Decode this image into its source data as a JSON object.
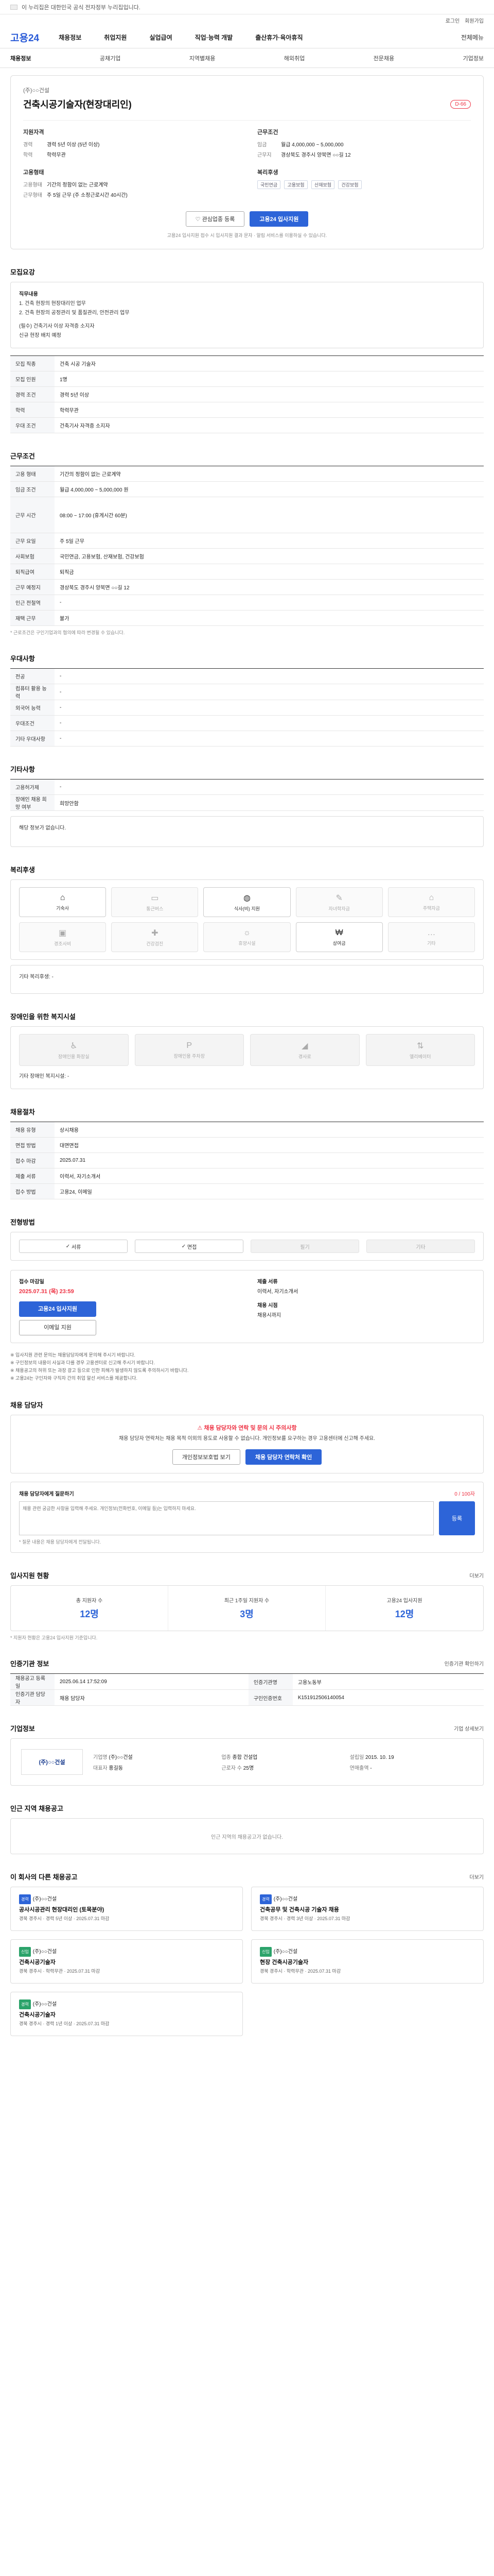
{
  "topbar": {
    "text": "이 누리집은 대한민국 공식 전자정부 누리집입니다."
  },
  "util": {
    "login": "로그인",
    "join": "회원가입"
  },
  "header": {
    "logo": "고용24",
    "gnb": [
      "채용정보",
      "취업지원",
      "실업급여",
      "직업·능력 개발",
      "출산휴가·육아휴직"
    ],
    "allmenu": "전체메뉴"
  },
  "subnav": [
    "채용정보",
    "공채기업",
    "지역별채용",
    "해외취업",
    "전문채용",
    "기업정보"
  ],
  "job": {
    "company": "(주)○○건설",
    "title": "건축시공기술자(현장대리인)",
    "dday": "D-66",
    "left_heading": "지원자격",
    "left": [
      {
        "k": "경력",
        "v": "경력 5년 이상 (5년 이상)"
      },
      {
        "k": "학력",
        "v": "학력무관"
      }
    ],
    "left_heading2": "고용형태",
    "left2": [
      {
        "k": "고용형태",
        "v": "기간의 정함이 없는 근로계약"
      },
      {
        "k": "근무형태",
        "v": "주 5일 근무 (주 소정근로시간 40시간)"
      }
    ],
    "right_heading": "근무조건",
    "right": [
      {
        "k": "임금",
        "v": "월급 4,000,000 ~ 5,000,000"
      },
      {
        "k": "근무지",
        "v": "경상북도 경주시 양북면 ○○길 12"
      }
    ],
    "right_heading2": "복리후생",
    "chips": [
      "국민연금",
      "고용보험",
      "산재보험",
      "건강보험"
    ],
    "btn_save": "관심업종 등록",
    "btn_apply": "고용24 입사지원",
    "notice": "고용24 입사지원 접수 시 입사지원 결과 문자 · 알림 서비스를 이용하실 수 있습니다."
  },
  "recruit": {
    "title": "모집요강",
    "sub": "직무내용",
    "lines": [
      "1. 건축 현장의 현장대리인 업무",
      "2. 건축 현장의 공정관리 및 품질관리, 안전관리 업무",
      "(필수) 건축기사 이상 자격증 소지자",
      "신규 현장 배치 예정"
    ],
    "table": [
      {
        "k": "모집 직종",
        "v": "건축 시공 기술자"
      },
      {
        "k": "모집 인원",
        "v": "1명"
      },
      {
        "k": "경력 조건",
        "v": "경력 5년 이상"
      },
      {
        "k": "학력",
        "v": "학력무관"
      },
      {
        "k": "우대 조건",
        "v": "건축기사 자격증 소지자"
      }
    ]
  },
  "conditions": {
    "title": "근무조건",
    "table": [
      {
        "k": "고용 형태",
        "v": "기간의 정함이 없는 근로계약"
      },
      {
        "k": "임금 조건",
        "v": "월급 4,000,000 ~ 5,000,000 원"
      },
      {
        "k": "근무 시간",
        "v": "08:00 ~ 17:00 (휴게시간 60분)"
      },
      {
        "k": "근무 요일",
        "v": "주 5일 근무"
      },
      {
        "k": "사회보험",
        "v": "국민연금, 고용보험, 산재보험, 건강보험"
      },
      {
        "k": "퇴직급여",
        "v": "퇴직금"
      },
      {
        "k": "근무 예정지",
        "v": "경상북도 경주시 양북면 ○○길 12"
      },
      {
        "k": "인근 전철역",
        "v": "-"
      },
      {
        "k": "재택 근무",
        "v": "불가"
      }
    ],
    "note": "* 근로조건은 구인기업과의 협의에 따라 변경될 수 있습니다."
  },
  "preference": {
    "title": "우대사항",
    "table": [
      {
        "k": "전공",
        "v": "-"
      },
      {
        "k": "컴퓨터 활용 능력",
        "v": "-"
      },
      {
        "k": "외국어 능력",
        "v": "-"
      },
      {
        "k": "우대조건",
        "v": "-"
      },
      {
        "k": "기타 우대사항",
        "v": "-"
      }
    ]
  },
  "extra": {
    "title": "기타사항",
    "table": [
      {
        "k": "고용허가제",
        "v": "-"
      },
      {
        "k": "장애인 채용 희망 여부",
        "v": "희망안함"
      }
    ],
    "box": "해당 정보가 없습니다."
  },
  "welfare": {
    "title": "복리후생",
    "items": [
      {
        "icon": "gift-icon",
        "label": "기숙사",
        "on": true
      },
      {
        "icon": "car-icon",
        "label": "통근버스",
        "on": false
      },
      {
        "icon": "meal-icon",
        "label": "식사(비) 지원",
        "on": true
      },
      {
        "icon": "coffee-icon",
        "label": "자녀학자금",
        "on": false
      },
      {
        "icon": "home-icon",
        "label": "주택자금",
        "on": false
      },
      {
        "icon": "book-icon",
        "label": "경조사비",
        "on": false
      },
      {
        "icon": "heart-icon",
        "label": "건강검진",
        "on": false
      },
      {
        "icon": "plane-icon",
        "label": "휴양시설",
        "on": false
      },
      {
        "icon": "money-icon",
        "label": "상여금",
        "on": true
      },
      {
        "icon": "star-icon",
        "label": "기타",
        "on": false
      }
    ],
    "other": "기타 복리후생: -"
  },
  "disability": {
    "title": "장애인을 위한 복지시설",
    "items": [
      "장애인용 화장실",
      "장애인용 주차장",
      "경사로",
      "엘리베이터"
    ],
    "other": "기타 장애인 복지시설: -"
  },
  "apply_info": {
    "title": "채용절차",
    "table": [
      {
        "k": "채용 유형",
        "v": "상시채용"
      },
      {
        "k": "면접 방법",
        "v": "대면면접"
      },
      {
        "k": "접수 마감",
        "v": "2025.07.31"
      },
      {
        "k": "제출 서류",
        "v": "이력서, 자기소개서"
      },
      {
        "k": "접수 방법",
        "v": "고용24, 이메일"
      }
    ]
  },
  "method": {
    "title": "전형방법",
    "items": [
      {
        "label": "서류",
        "on": true
      },
      {
        "label": "면접",
        "on": true
      },
      {
        "label": "필기",
        "on": false
      },
      {
        "label": "기타",
        "on": false
      }
    ]
  },
  "apply_box": {
    "h1": "접수 마감일",
    "date": "2025.07.31 (목) 23:59",
    "btn": "고용24 입사지원",
    "btn2": "이메일 지원",
    "h2": "제출 서류",
    "docs": "이력서, 자기소개서",
    "h3": "채용 시점",
    "time": "채용시까지"
  },
  "notes": [
    "※ 입사지원 관련 문의는 채용담당자에게 문의해 주시기 바랍니다.",
    "※ 구인정보의 내용이 사실과 다를 경우 고용센터로 신고해 주시기 바랍니다.",
    "※ 채용공고의 허위 또는 과장 광고 등으로 인한 피해가 발생하지 않도록 주의하시기 바랍니다.",
    "※ 고용24는 구인자와 구직자 간의 취업 알선 서비스를 제공합니다."
  ],
  "manager": {
    "title": "채용 담당자",
    "alert_title": "채용 담당자와 연락 및 문의 시 주의사항",
    "alert_desc": "채용 담당자 연락처는 채용 목적 이외의 용도로 사용할 수 없습니다. 개인정보를 요구하는 경우 고용센터에 신고해 주세요.",
    "btn1": "개인정보보호법 보기",
    "btn2": "채용 담당자 연락처 확인"
  },
  "comment": {
    "title": "채용 담당자에게 질문하기",
    "count": "0 / 100자",
    "placeholder": "채용 관련 궁금한 사항을 입력해 주세요. 개인정보(전화번호, 이메일 등)는 입력하지 마세요.",
    "send": "등록",
    "note": "* 질문 내용은 채용 담당자에게 전달됩니다."
  },
  "stats": {
    "title": "입사지원 현황",
    "more": "더보기",
    "items": [
      {
        "label": "총 지원자 수",
        "value": "12명"
      },
      {
        "label": "최근 1주일 지원자 수",
        "value": "3명"
      },
      {
        "label": "고용24 입사지원",
        "value": "12명"
      }
    ],
    "note": "* 지원자 현황은 고용24 입사지원 기준입니다."
  },
  "reg": {
    "title": "인증기관 정보",
    "more": "인증기관 확인하기",
    "table": [
      {
        "k": "채용공고 등록일",
        "v": "2025.06.14 17:52:09"
      },
      {
        "k": "인증기관명",
        "v": "고용노동부"
      },
      {
        "k": "인증기관 담당자",
        "v": "채용 담당자"
      },
      {
        "k": "구인인증번호",
        "v": "K151912506140054"
      }
    ]
  },
  "company": {
    "title": "기업정보",
    "more": "기업 상세보기",
    "logo": "(주)○○건설",
    "fields": [
      {
        "k": "기업명",
        "v": "(주)○○건설"
      },
      {
        "k": "업종",
        "v": "종합 건설업"
      },
      {
        "k": "설립일",
        "v": "2015. 10. 19"
      },
      {
        "k": "대표자",
        "v": "홍길동"
      },
      {
        "k": "근로자 수",
        "v": "25명"
      },
      {
        "k": "연매출액",
        "v": "-"
      }
    ]
  },
  "similar": {
    "title": "인근 지역 채용공고",
    "empty": "인근 지역의 채용공고가 없습니다."
  },
  "recommend": {
    "title": "이 회사의 다른 채용공고",
    "more": "더보기",
    "items": [
      {
        "badge": "경력",
        "badge_g": false,
        "company": "(주)○○건설",
        "title": "공사시공관리 현장대리인 (토목분야)",
        "meta": "경북 경주시 · 경력 5년 이상 · 2025.07.31 마감"
      },
      {
        "badge": "경력",
        "badge_g": false,
        "company": "(주)○○건설",
        "title": "건축공무 및 건축시공 기술자 채용",
        "meta": "경북 경주시 · 경력 3년 이상 · 2025.07.31 마감"
      },
      {
        "badge": "신입",
        "badge_g": true,
        "company": "(주)○○건설",
        "title": "건축시공기술자",
        "meta": "경북 경주시 · 학력무관 · 2025.07.31 마감"
      },
      {
        "badge": "신입",
        "badge_g": true,
        "company": "(주)○○건설",
        "title": "현장 건축시공기술자",
        "meta": "경북 경주시 · 학력무관 · 2025.07.31 마감"
      },
      {
        "badge": "경력",
        "badge_g": true,
        "company": "(주)○○건설",
        "title": "건축시공기술자",
        "meta": "경북 경주시 · 경력 1년 이상 · 2025.07.31 마감"
      }
    ]
  }
}
